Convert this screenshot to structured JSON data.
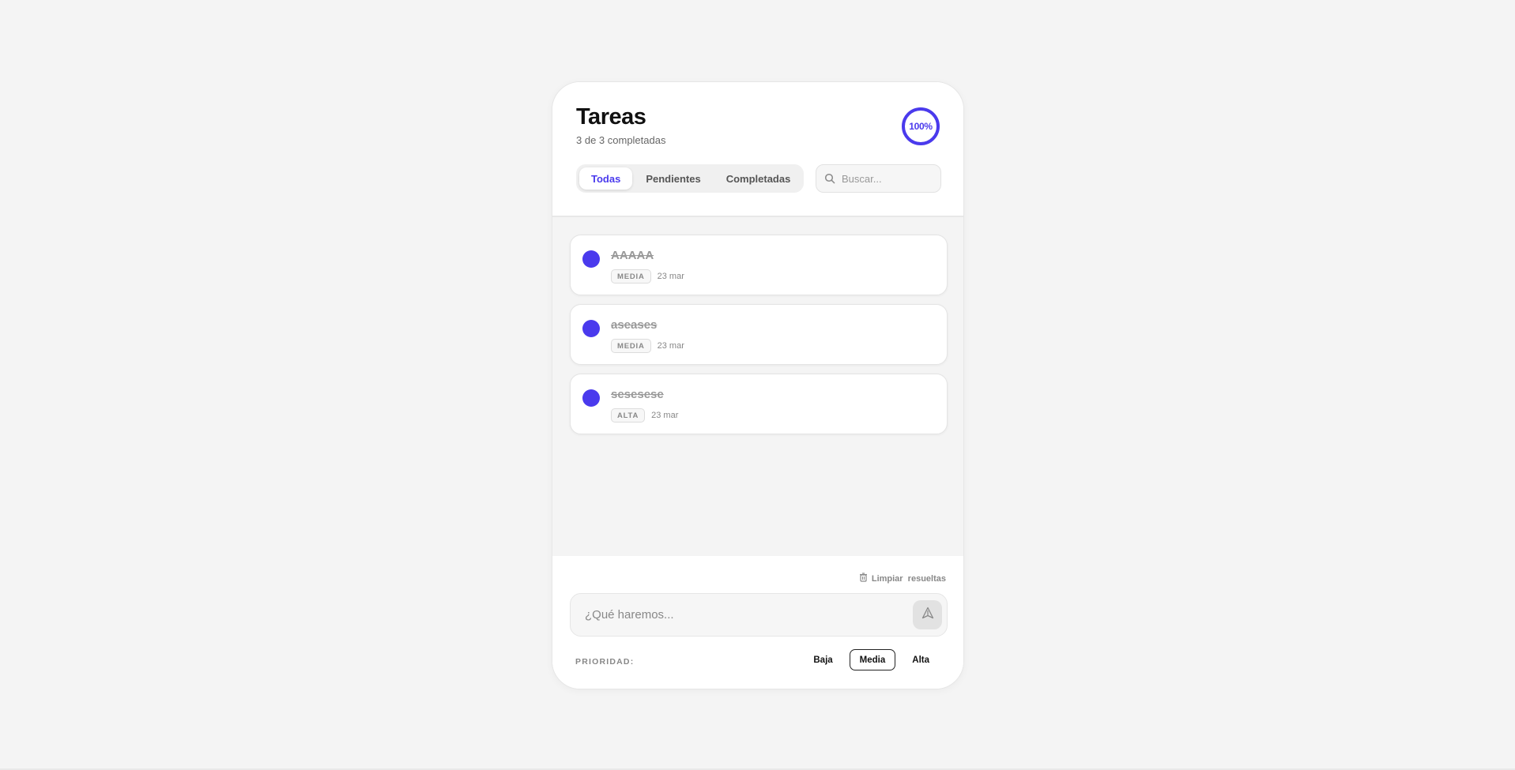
{
  "header": {
    "title": "Tareas",
    "subtitle": "3 de 3 completadas",
    "progress_text": "100%",
    "progress_fraction": 1.0,
    "accent_color": "#4a3aed"
  },
  "tabs": [
    {
      "label": "Todas",
      "active": true
    },
    {
      "label": "Pendientes",
      "active": false
    },
    {
      "label": "Completadas",
      "active": false
    }
  ],
  "search": {
    "placeholder": "Buscar...",
    "icon": "search-icon"
  },
  "tasks": [
    {
      "title": "AAAAA",
      "priority": "MEDIA",
      "date": "23 mar",
      "completed": true
    },
    {
      "title": "aseases",
      "priority": "MEDIA",
      "date": "23 mar",
      "completed": true
    },
    {
      "title": "sesesese",
      "priority": "ALTA",
      "date": "23 mar",
      "completed": true
    }
  ],
  "footer": {
    "clear_label": "Limpiar  resueltas",
    "clear_icon": "trash-icon",
    "new_task_placeholder": "¿Qué haremos...",
    "send_icon": "send-icon",
    "priority_label": "PRIORIDAD:",
    "priorities": [
      {
        "label": "Baja",
        "active": false
      },
      {
        "label": "Media",
        "active": true
      },
      {
        "label": "Alta",
        "active": false
      }
    ]
  }
}
